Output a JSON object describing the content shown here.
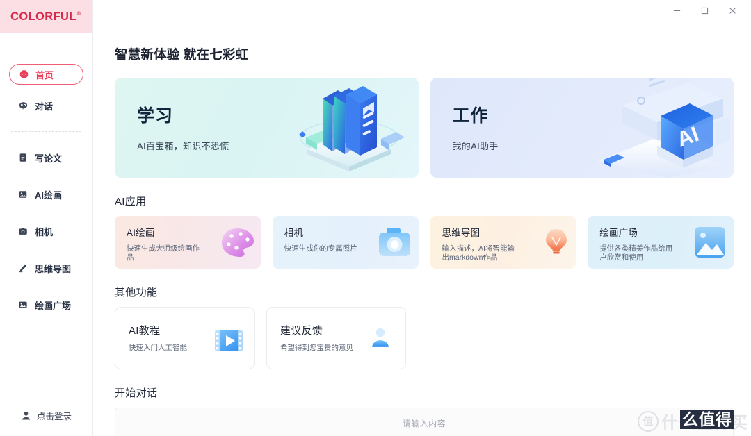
{
  "window": {
    "controls": [
      {
        "name": "minimize",
        "glyph": "minimize-icon"
      },
      {
        "name": "maximize",
        "glyph": "maximize-icon"
      },
      {
        "name": "close",
        "glyph": "close-icon"
      }
    ]
  },
  "sidebar": {
    "logo": "COLORFUL",
    "logo_registered": "®",
    "brand_band_color": "#fbdfe4",
    "brand_text_color": "#d6294b",
    "primary_items": [
      {
        "label": "首页",
        "icon": "home-chat-icon",
        "active": true
      },
      {
        "label": "对话",
        "icon": "robot-chat-icon",
        "active": false
      }
    ],
    "secondary_items": [
      {
        "label": "写论文",
        "icon": "document-icon",
        "active": false
      },
      {
        "label": "AI绘画",
        "icon": "image-icon",
        "active": false
      },
      {
        "label": "相机",
        "icon": "camera-icon",
        "active": false
      },
      {
        "label": "思维导图",
        "icon": "pen-icon",
        "active": false
      },
      {
        "label": "绘画广场",
        "icon": "gallery-icon",
        "active": false
      }
    ],
    "login": {
      "label": "点击登录",
      "icon": "user-icon"
    }
  },
  "main": {
    "page_title": "智慧新体验 就在七彩虹",
    "hero_cards": [
      {
        "title": "学习",
        "subtitle": "AI百宝箱，知识不恐慌",
        "art": "books-illustration",
        "bg": "#dff6f1"
      },
      {
        "title": "工作",
        "subtitle": "我的AI助手",
        "art": "ai-monitor-illustration",
        "bg": "#dfe8fb"
      }
    ],
    "sections": [
      {
        "heading": "AI应用",
        "cards": [
          {
            "title": "AI绘画",
            "desc": "快速生成大师级绘画作品",
            "art": "palette-icon",
            "bg": "#fbe9e1"
          },
          {
            "title": "相机",
            "desc": "快速生成你的专属照片",
            "art": "camera-icon",
            "bg": "#e6f3fb"
          },
          {
            "title": "思维导图",
            "desc": "输入描述，AI将智能输出markdown作品",
            "art": "lightbulb-icon",
            "bg": "#fdf2e0"
          },
          {
            "title": "绘画广场",
            "desc": "提供各类精美作品给用户欣赏和使用",
            "art": "picture-icon",
            "bg": "#dff0f9"
          }
        ]
      },
      {
        "heading": "其他功能",
        "cards": [
          {
            "title": "AI教程",
            "desc": "快速入门人工智能",
            "art": "video-play-icon"
          },
          {
            "title": "建议反馈",
            "desc": "希望得到您宝贵的意见",
            "art": "person-feedback-icon"
          }
        ]
      }
    ],
    "chat": {
      "heading": "开始对话",
      "placeholder": "请输入内容",
      "value": ""
    }
  },
  "watermark": {
    "mark": "值",
    "text": "什么值得买",
    "highlight": "么值得"
  }
}
